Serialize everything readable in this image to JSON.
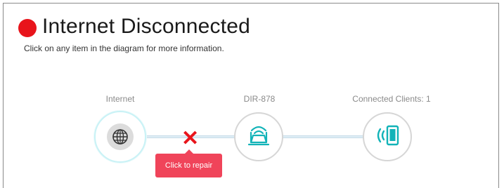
{
  "header": {
    "status_color": "#e8141b",
    "title": "Internet Disconnected",
    "subtitle": "Click on any item in the diagram for more information."
  },
  "diagram": {
    "internet": {
      "label": "Internet",
      "icon": "globe-icon"
    },
    "router": {
      "label": "DIR-878",
      "icon": "router-icon"
    },
    "clients": {
      "label": "Connected Clients: 1",
      "icon": "wireless-device-icon"
    },
    "error_mark": "✕",
    "repair_button": "Click to repair"
  },
  "colors": {
    "accent": "#12b3b8",
    "error": "#e8141b",
    "repair_button": "#f0445a"
  }
}
